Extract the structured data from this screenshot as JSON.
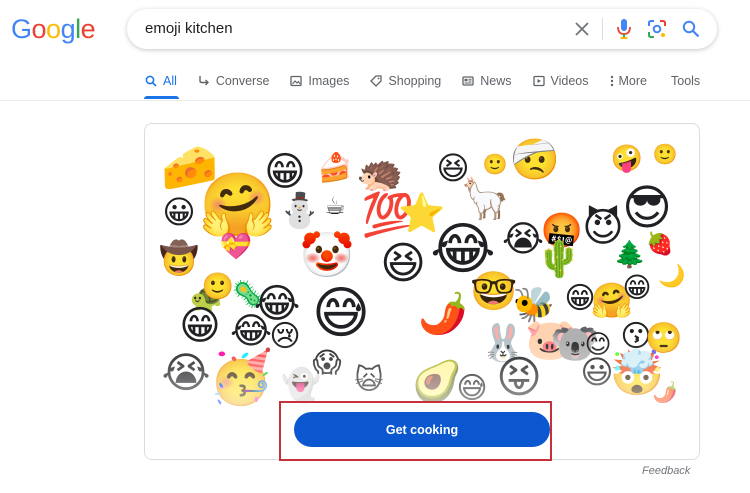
{
  "logo": {
    "letters": [
      {
        "char": "G",
        "color": "#4285F4"
      },
      {
        "char": "o",
        "color": "#EA4335"
      },
      {
        "char": "o",
        "color": "#FBBC05"
      },
      {
        "char": "g",
        "color": "#4285F4"
      },
      {
        "char": "l",
        "color": "#34A853"
      },
      {
        "char": "e",
        "color": "#EA4335"
      }
    ]
  },
  "search": {
    "query": "emoji kitchen",
    "icons": [
      "close-icon",
      "mic-icon",
      "lens-icon",
      "search-icon"
    ]
  },
  "tabs": [
    {
      "label": "All",
      "icon": "search-icon",
      "active": true
    },
    {
      "label": "Converse",
      "icon": "converse-arrow-icon",
      "active": false
    },
    {
      "label": "Images",
      "icon": "image-icon",
      "active": false
    },
    {
      "label": "Shopping",
      "icon": "tag-icon",
      "active": false
    },
    {
      "label": "News",
      "icon": "news-icon",
      "active": false
    },
    {
      "label": "Videos",
      "icon": "play-icon",
      "active": false
    },
    {
      "label": "More",
      "icon": "more-dots-icon",
      "active": false
    }
  ],
  "tools_label": "Tools",
  "emoji_kitchen": {
    "stickers": [
      "🧀",
      "😁",
      "🍰",
      "🦔",
      "😆",
      "🙂",
      "🤕",
      "🤪",
      "🙂",
      "😀",
      "🤗",
      "⛄",
      "☕",
      "💯",
      "⭐",
      "🦙",
      "🤬",
      "😈",
      "😎",
      "🤠",
      "💝",
      "🤡",
      "😆",
      "😂",
      "😭",
      "🌵",
      "🌲",
      "🍓",
      "🐢",
      "🙂",
      "🦠",
      "😂",
      "😅",
      "🤓",
      "🌶️",
      "🐝",
      "😁",
      "🤗",
      "😁",
      "🌙",
      "😁",
      "😂",
      "😢",
      "😱",
      "🐷",
      "🐰",
      "🐨",
      "😊",
      "😗",
      "🙄",
      "😭",
      "🥳",
      "👻",
      "🙀",
      "🥑",
      "😅",
      "😝",
      "😃",
      "🤯",
      "🌶️"
    ],
    "cta_label": "Get cooking"
  },
  "feedback_label": "Feedback",
  "colors": {
    "accent": "#1a73e8",
    "cta_background": "#0b57d0",
    "highlight_frame": "#c5303a"
  }
}
